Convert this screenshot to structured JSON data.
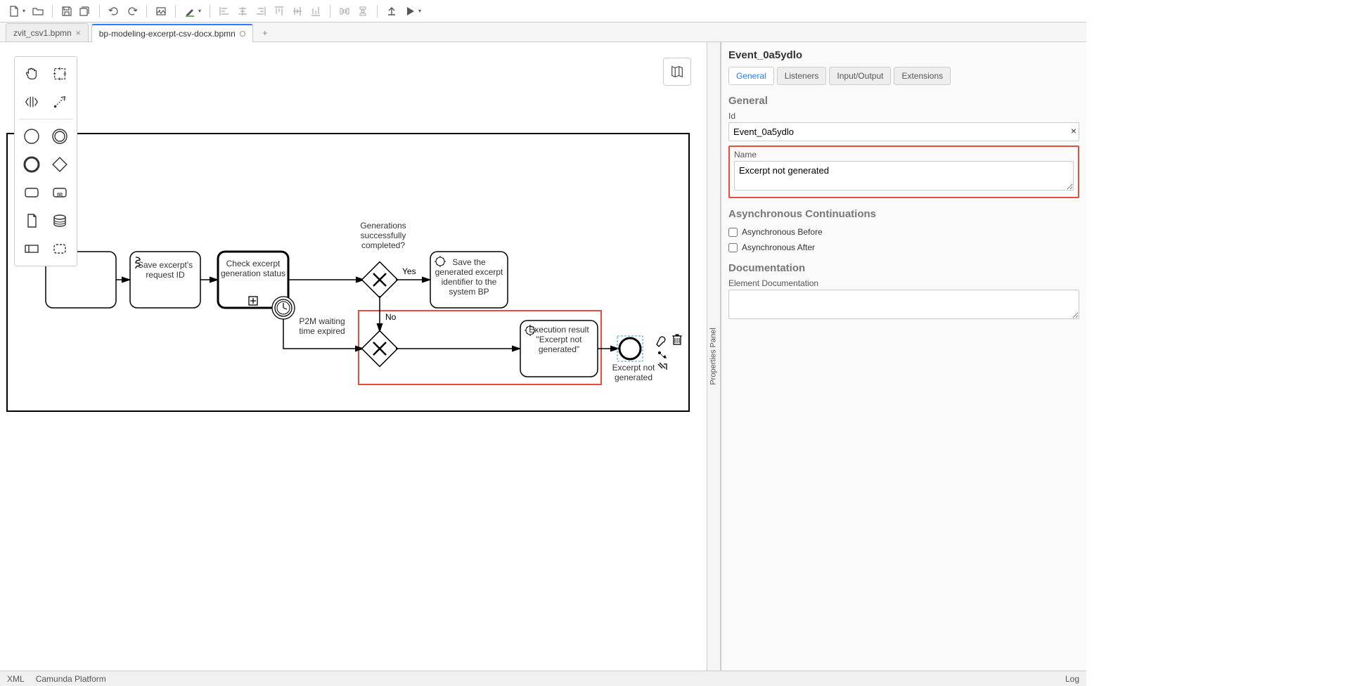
{
  "tabs": [
    {
      "name": "zvit_csv1.bpmn",
      "active": false,
      "closeIcon": true
    },
    {
      "name": "bp-modeling-excerpt-csv-docx.bpmn",
      "active": true,
      "closeIcon": false
    }
  ],
  "diagram": {
    "saveExcerpt": "Save excerpt's request ID",
    "checkExcerpt": "Check excerpt generation status",
    "timerLabel": "P2M waiting time expired",
    "gatewayTopLabel": "Generations successfully completed?",
    "gatewayYes": "Yes",
    "gatewayNo": "No",
    "saveGenerated": "Save the generated excerpt identifier to the system BP",
    "executionResult": "Execution result \"Excerpt not generated\"",
    "endEventLabel": "Excerpt not generated"
  },
  "propPanel": {
    "title": "Event_0a5ydlo",
    "tabs": [
      "General",
      "Listeners",
      "Input/Output",
      "Extensions"
    ],
    "activeTab": "General",
    "section1": "General",
    "idLabel": "Id",
    "idValue": "Event_0a5ydlo",
    "nameLabel": "Name",
    "nameValue": "Excerpt not generated",
    "section2": "Asynchronous Continuations",
    "asyncBefore": "Asynchronous Before",
    "asyncAfter": "Asynchronous After",
    "section3": "Documentation",
    "docLabel": "Element Documentation"
  },
  "propToggle": "Properties Panel",
  "statusBar": {
    "xml": "XML",
    "platform": "Camunda Platform",
    "log": "Log"
  }
}
